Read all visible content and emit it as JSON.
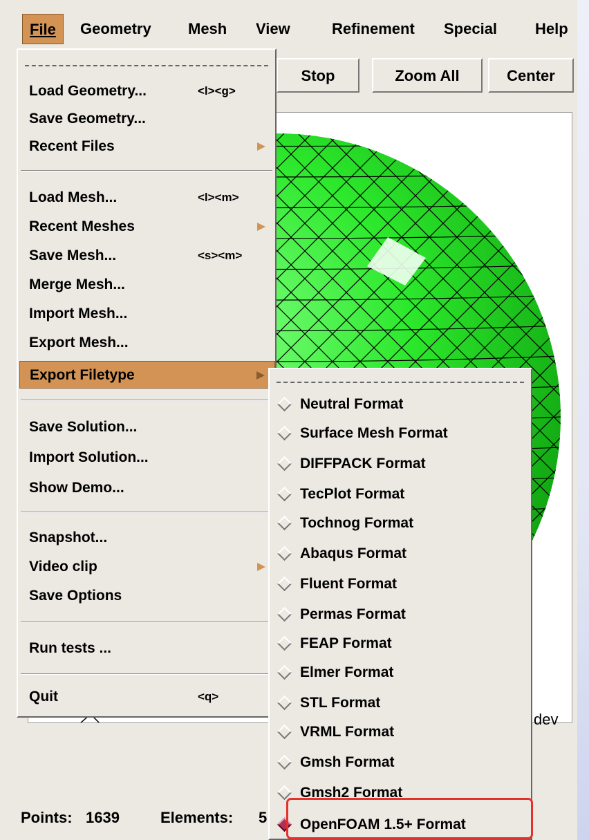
{
  "menubar": {
    "items": [
      {
        "label": "File"
      },
      {
        "label": "Geometry"
      },
      {
        "label": "Mesh"
      },
      {
        "label": "View"
      },
      {
        "label": "Refinement"
      },
      {
        "label": "Special"
      },
      {
        "label": "Help"
      }
    ]
  },
  "toolbar": {
    "stop_label": "Stop",
    "zoom_all_label": "Zoom All",
    "center_label": "Center"
  },
  "viewport": {
    "corner_text": "dev",
    "mesh_color": "#22dd22"
  },
  "status": {
    "points_label": "Points:",
    "points_value": "1639",
    "elements_label": "Elements:",
    "elements_value": "5"
  },
  "file_menu": {
    "items": [
      {
        "label": "Load Geometry...",
        "accel": "<l><g>"
      },
      {
        "label": "Save Geometry...",
        "accel": ""
      },
      {
        "label": "Recent Files",
        "accel": ""
      },
      {
        "label": "Load Mesh...",
        "accel": "<l><m>"
      },
      {
        "label": "Recent Meshes",
        "accel": ""
      },
      {
        "label": "Save Mesh...",
        "accel": "<s><m>"
      },
      {
        "label": "Merge Mesh...",
        "accel": ""
      },
      {
        "label": "Import Mesh...",
        "accel": ""
      },
      {
        "label": "Export Mesh...",
        "accel": ""
      },
      {
        "label": "Export Filetype",
        "accel": ""
      },
      {
        "label": "Save Solution...",
        "accel": ""
      },
      {
        "label": "Import Solution...",
        "accel": ""
      },
      {
        "label": "Show Demo...",
        "accel": ""
      },
      {
        "label": "Snapshot...",
        "accel": ""
      },
      {
        "label": "Video clip",
        "accel": ""
      },
      {
        "label": "Save Options",
        "accel": ""
      },
      {
        "label": "Run tests ...",
        "accel": ""
      },
      {
        "label": "Quit",
        "accel": "<q>"
      }
    ]
  },
  "export_submenu": {
    "items": [
      {
        "label": "Neutral Format"
      },
      {
        "label": "Surface Mesh Format"
      },
      {
        "label": "DIFFPACK Format"
      },
      {
        "label": "TecPlot Format"
      },
      {
        "label": "Tochnog Format"
      },
      {
        "label": "Abaqus Format"
      },
      {
        "label": "Fluent Format"
      },
      {
        "label": "Permas Format"
      },
      {
        "label": "FEAP Format"
      },
      {
        "label": "Elmer Format"
      },
      {
        "label": "STL Format"
      },
      {
        "label": "VRML Format"
      },
      {
        "label": "Gmsh Format"
      },
      {
        "label": "Gmsh2 Format"
      },
      {
        "label": "OpenFOAM 1.5+ Format"
      }
    ],
    "selected": "OpenFOAM 1.5+ Format"
  },
  "accent_color": "#d39354",
  "callout_color": "#e5312b"
}
